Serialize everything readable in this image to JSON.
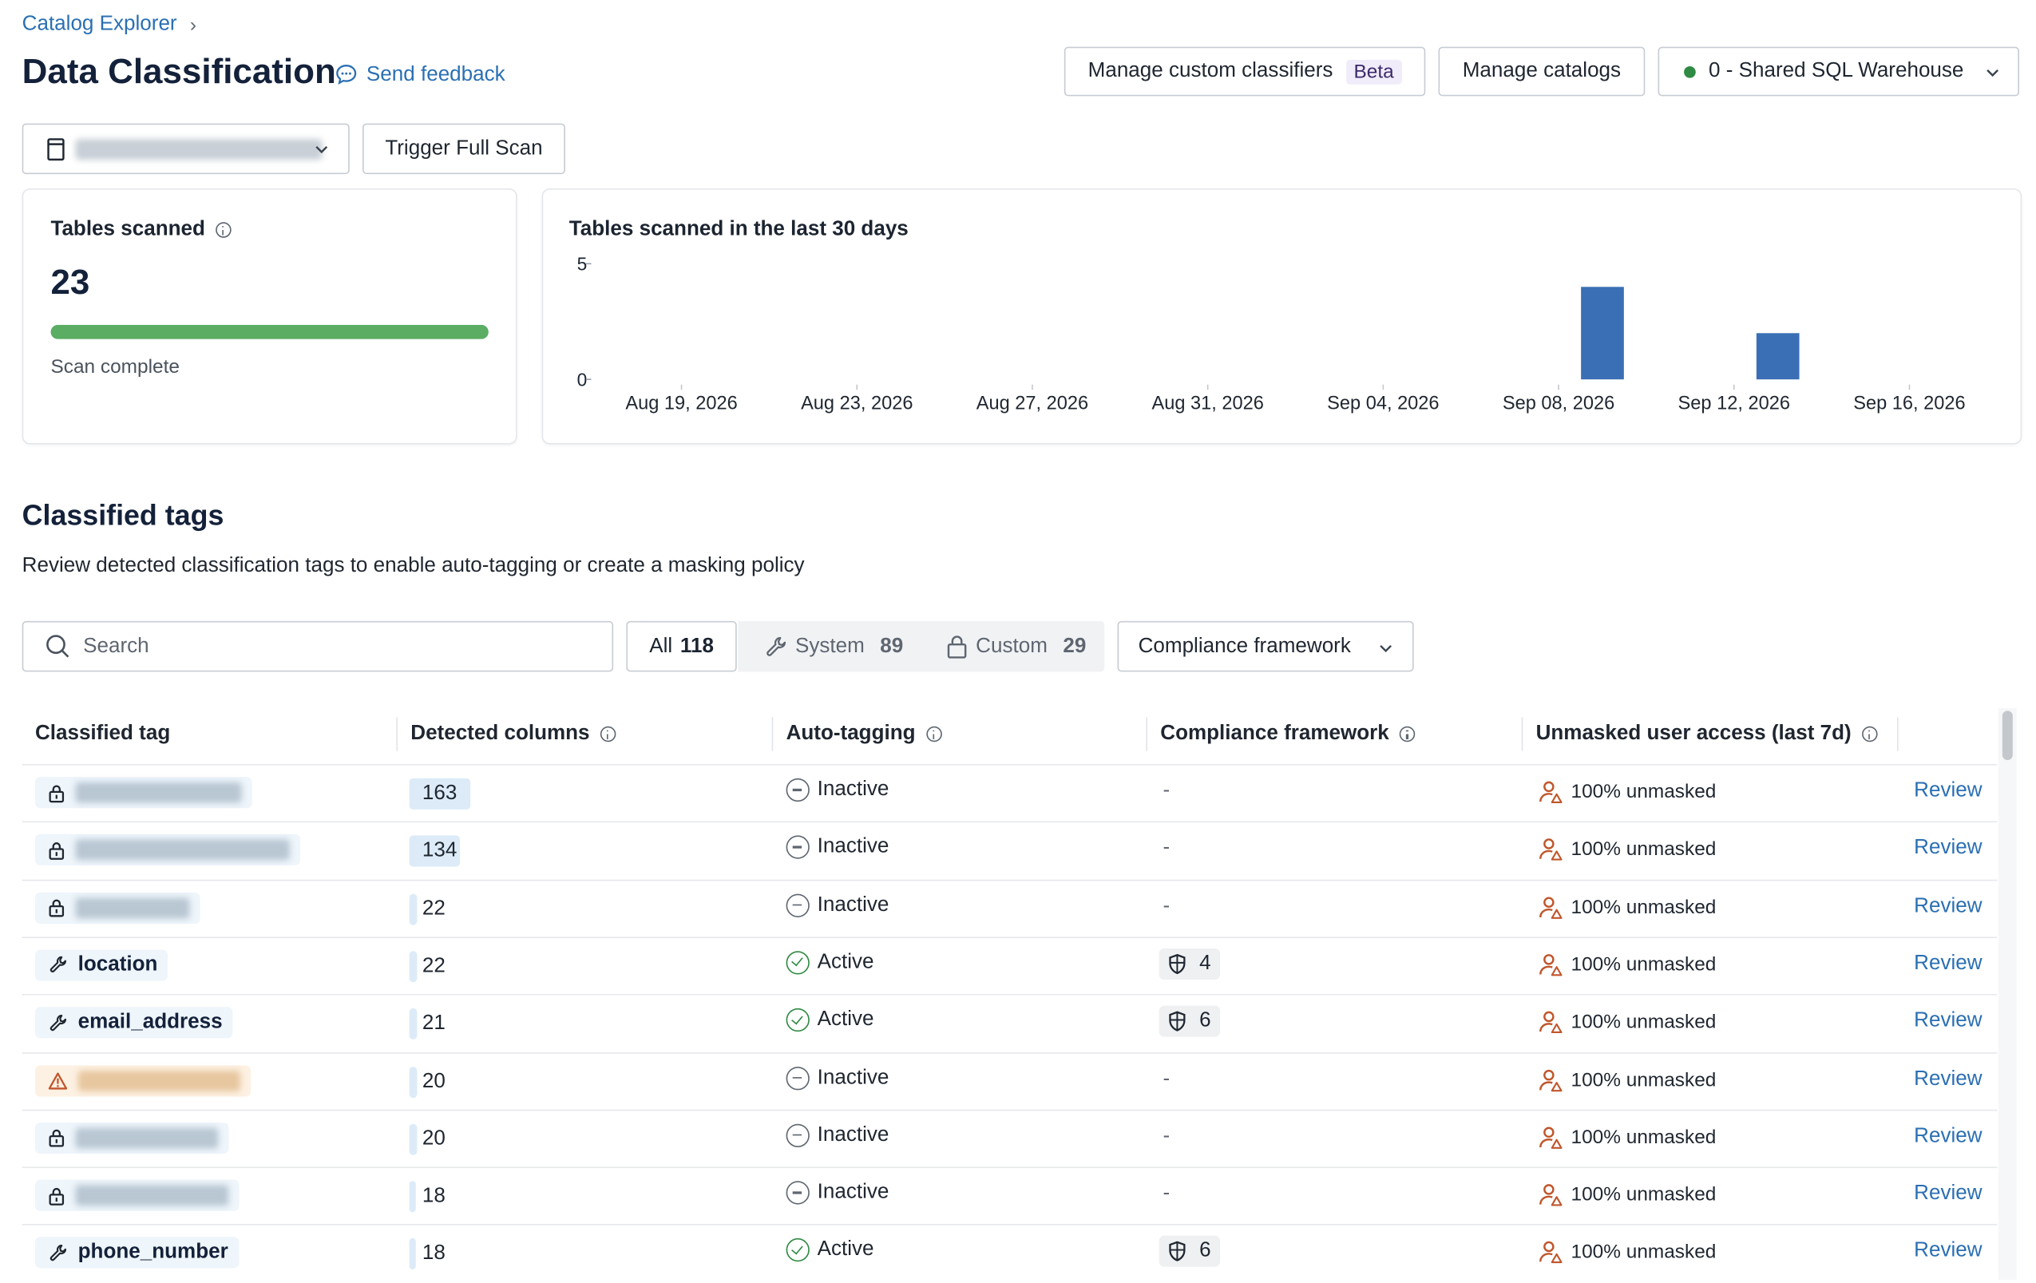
{
  "breadcrumb": {
    "parent": "Catalog Explorer",
    "separator": "›"
  },
  "header": {
    "title": "Data Classification",
    "feedback_label": "Send feedback",
    "manage_custom_label": "Manage custom classifiers",
    "beta_label": "Beta",
    "manage_catalogs_label": "Manage catalogs",
    "warehouse_label": "0 - Shared SQL Warehouse",
    "warehouse_status_color": "#2f8a43"
  },
  "toolbar": {
    "catalog_value": "",
    "trigger_scan_label": "Trigger Full Scan"
  },
  "scan_card": {
    "title": "Tables scanned",
    "value": "23",
    "progress": 1.0,
    "status": "Scan complete",
    "progress_color": "#5aad62"
  },
  "chart_data": {
    "type": "bar",
    "title": "Tables scanned in the last 30 days",
    "xlabel": "",
    "ylabel": "",
    "ylim": [
      0,
      5
    ],
    "y_ticks": [
      "5",
      "0"
    ],
    "x_tick_labels": [
      "Aug 19, 2026",
      "Aug 23, 2026",
      "Aug 27, 2026",
      "Aug 31, 2026",
      "Sep 04, 2026",
      "Sep 08, 2026",
      "Sep 12, 2026",
      "Sep 16, 2026"
    ],
    "categories": [
      "Sep 09, 2026",
      "Sep 13, 2026"
    ],
    "values": [
      4,
      2
    ],
    "bar_color": "#3a6fb5"
  },
  "section": {
    "title": "Classified tags",
    "description": "Review detected classification tags to enable auto-tagging or create a masking policy"
  },
  "filters": {
    "search_placeholder": "Search",
    "all_label": "All",
    "all_count": "118",
    "system_label": "System",
    "system_count": "89",
    "custom_label": "Custom",
    "custom_count": "29",
    "compliance_label": "Compliance framework"
  },
  "table": {
    "columns": [
      "Classified tag",
      "Detected columns",
      "Auto-tagging",
      "Compliance framework",
      "Unmasked user access (last 7d)"
    ],
    "rows": [
      {
        "tag": "",
        "tag_type": "lock",
        "detected": "163",
        "detected_ratio": 1.0,
        "status": "Inactive",
        "framework": "-",
        "access": "100% unmasked",
        "action": "Review"
      },
      {
        "tag": "",
        "tag_type": "lock",
        "detected": "134",
        "detected_ratio": 0.82,
        "status": "Inactive",
        "framework": "-",
        "access": "100% unmasked",
        "action": "Review"
      },
      {
        "tag": "",
        "tag_type": "lock",
        "detected": "22",
        "detected_ratio": 0.13,
        "status": "Inactive",
        "framework": "-",
        "access": "100% unmasked",
        "action": "Review"
      },
      {
        "tag": "location",
        "tag_type": "system",
        "detected": "22",
        "detected_ratio": 0.13,
        "status": "Active",
        "framework": "4",
        "access": "100% unmasked",
        "action": "Review"
      },
      {
        "tag": "email_address",
        "tag_type": "system",
        "detected": "21",
        "detected_ratio": 0.13,
        "status": "Active",
        "framework": "6",
        "access": "100% unmasked",
        "action": "Review"
      },
      {
        "tag": "",
        "tag_type": "warning",
        "detected": "20",
        "detected_ratio": 0.12,
        "status": "Inactive",
        "framework": "-",
        "access": "100% unmasked",
        "action": "Review"
      },
      {
        "tag": "",
        "tag_type": "lock",
        "detected": "20",
        "detected_ratio": 0.12,
        "status": "Inactive",
        "framework": "-",
        "access": "100% unmasked",
        "action": "Review"
      },
      {
        "tag": "",
        "tag_type": "lock",
        "detected": "18",
        "detected_ratio": 0.11,
        "status": "Inactive",
        "framework": "-",
        "access": "100% unmasked",
        "action": "Review"
      },
      {
        "tag": "phone_number",
        "tag_type": "system",
        "detected": "18",
        "detected_ratio": 0.11,
        "status": "Active",
        "framework": "6",
        "access": "100% unmasked",
        "action": "Review"
      }
    ]
  }
}
